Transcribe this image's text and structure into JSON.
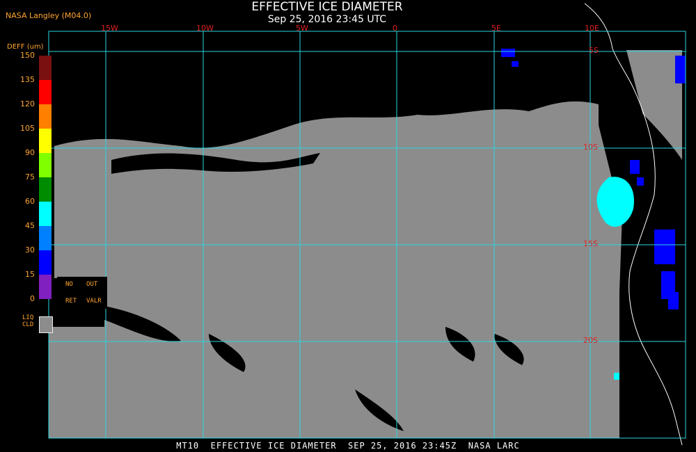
{
  "header": {
    "title": "EFFECTIVE ICE DIAMETER",
    "subtitle": "Sep 25, 2016 23:45 UTC",
    "source": "NASA Langley (M04.0)"
  },
  "footer": "MT10  EFFECTIVE ICE DIAMETER  SEP 25, 2016 23:45Z  NASA LARC",
  "grid": {
    "longitude_labels": [
      "15W",
      "10W",
      "5W",
      "0",
      "5E",
      "10E"
    ],
    "latitude_labels": [
      "5S",
      "10S",
      "15S",
      "20S"
    ],
    "line_color": "#28d8e0"
  },
  "colorbar": {
    "title": "DEFF (um)",
    "ticks": [
      "150",
      "135",
      "120",
      "105",
      "90",
      "75",
      "60",
      "45",
      "30",
      "15",
      "0"
    ],
    "colors": [
      "#7a1010",
      "#ff0000",
      "#ff7f00",
      "#ffff00",
      "#80ff00",
      "#008c00",
      "#00ffff",
      "#0080ff",
      "#0000ff",
      "#8020c0"
    ],
    "no_ret": "NO",
    "ret": "RET",
    "out": "OUT",
    "valr": "VALR",
    "liq_cld": "LIQ\nCLD",
    "liq_color": "#8c8c8c"
  },
  "map_colors": {
    "liquid_cloud": "#8c8c8c",
    "clear": "#000000",
    "coastline": "#ffffff"
  }
}
